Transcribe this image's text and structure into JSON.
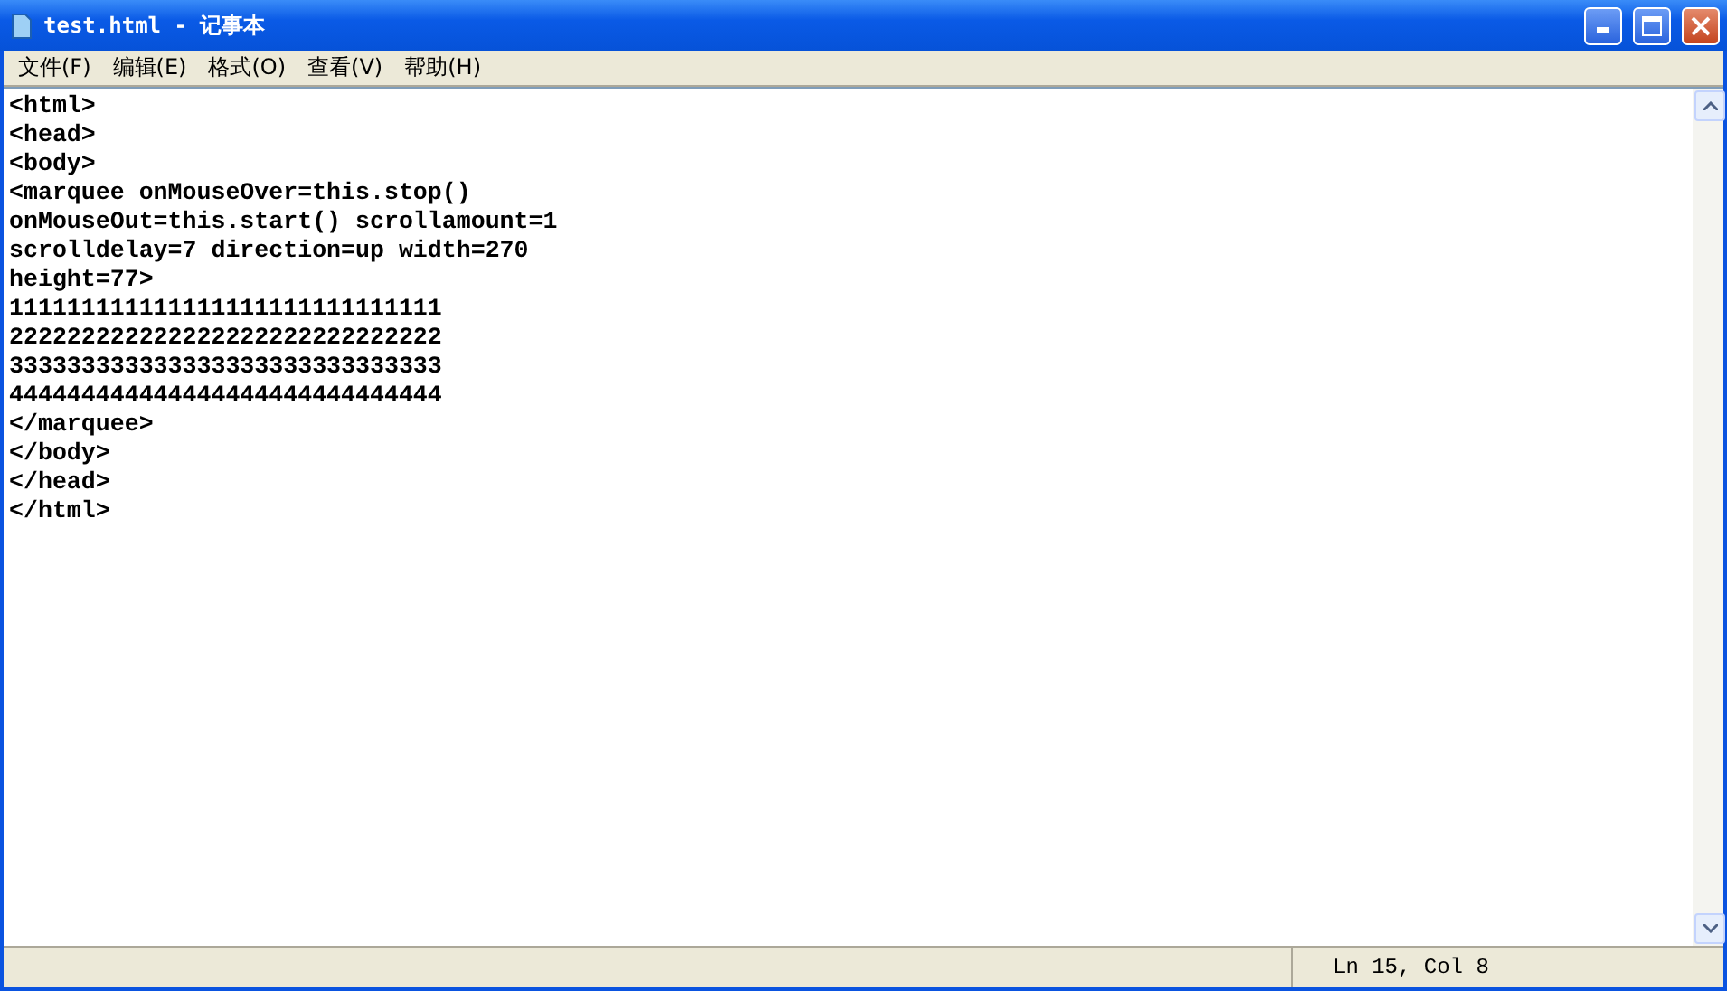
{
  "window": {
    "title": "test.html - 记事本"
  },
  "menu": [
    "文件(F)",
    "编辑(E)",
    "格式(O)",
    "查看(V)",
    "帮助(H)"
  ],
  "editor": {
    "lines": [
      "<html>",
      "<head>",
      "<body>",
      "<marquee onMouseOver=this.stop()",
      "onMouseOut=this.start() scrollamount=1",
      "scrolldelay=7 direction=up width=270",
      "height=77>",
      "111111111111111111111111111111",
      "222222222222222222222222222222",
      "333333333333333333333333333333",
      "444444444444444444444444444444",
      "</marquee>",
      "</body>",
      "</head>",
      "</html>"
    ]
  },
  "status_bar": {
    "position": "Ln 15, Col 8"
  }
}
